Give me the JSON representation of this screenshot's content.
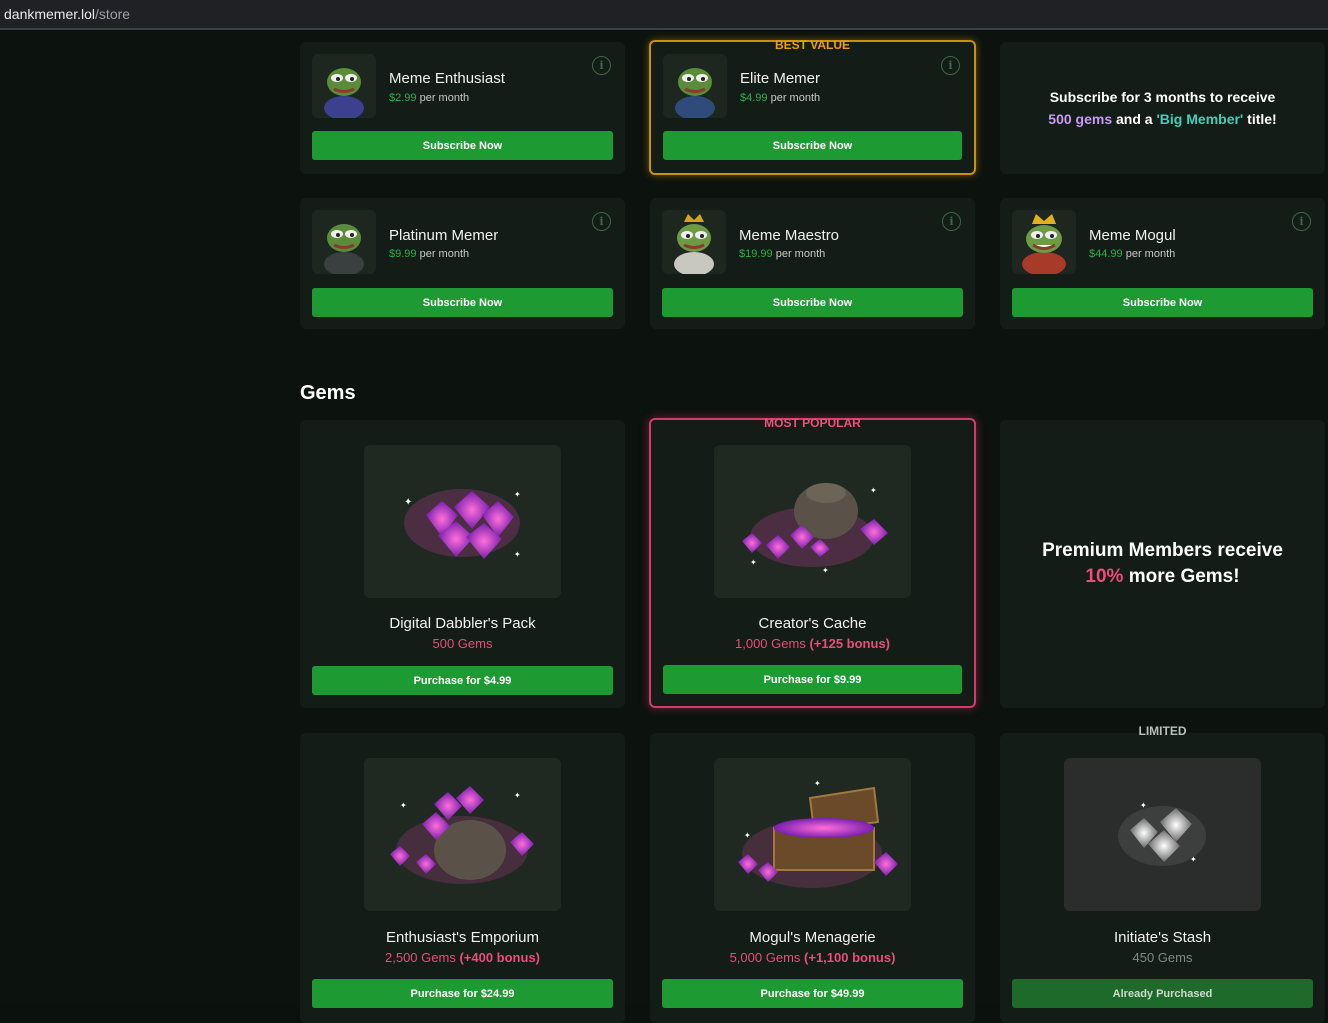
{
  "browser": {
    "url_host": "dankmemer.lol",
    "url_path": "/store"
  },
  "subscriptions": [
    {
      "name": "Meme Enthusiast",
      "price": "$2.99",
      "period": "per month",
      "button": "Subscribe Now"
    },
    {
      "name": "Elite Memer",
      "price": "$4.99",
      "period": "per month",
      "button": "Subscribe Now",
      "badge": "BEST VALUE"
    },
    {
      "name": "Platinum Memer",
      "price": "$9.99",
      "period": "per month",
      "button": "Subscribe Now"
    },
    {
      "name": "Meme Maestro",
      "price": "$19.99",
      "period": "per month",
      "button": "Subscribe Now"
    },
    {
      "name": "Meme Mogul",
      "price": "$44.99",
      "period": "per month",
      "button": "Subscribe Now"
    }
  ],
  "sub_promo": {
    "line1": "Subscribe for 3 months to receive",
    "gems": "500 gems",
    "and_a": " and a ",
    "title": "'Big Member'",
    "suffix": " title!"
  },
  "gems_section": {
    "title": "Gems"
  },
  "gem_packs": [
    {
      "name": "Digital Dabbler's Pack",
      "amount": "500 Gems",
      "bonus": "",
      "button": "Purchase for $4.99"
    },
    {
      "name": "Creator's Cache",
      "amount": "1,000 Gems",
      "bonus": "(+125 bonus)",
      "button": "Purchase for $9.99",
      "badge": "MOST POPULAR"
    },
    {
      "name": "Enthusiast's Emporium",
      "amount": "2,500 Gems",
      "bonus": "(+400 bonus)",
      "button": "Purchase for $24.99"
    },
    {
      "name": "Mogul's Menagerie",
      "amount": "5,000 Gems",
      "bonus": "(+1,100 bonus)",
      "button": "Purchase for $49.99"
    },
    {
      "name": "Initiate's Stash",
      "amount": "450 Gems",
      "bonus": "",
      "button": "Already Purchased",
      "badge": "LIMITED"
    }
  ],
  "gem_promo": {
    "line1": "Premium Members receive",
    "pct": "10%",
    "line2": " more Gems!"
  },
  "colors": {
    "accent_green": "#1e9a33",
    "gem_pink": "#ec4c7a",
    "best_value_gold": "#e9a10c",
    "promo_purple": "#c89af5",
    "promo_teal": "#3fd0b8"
  }
}
